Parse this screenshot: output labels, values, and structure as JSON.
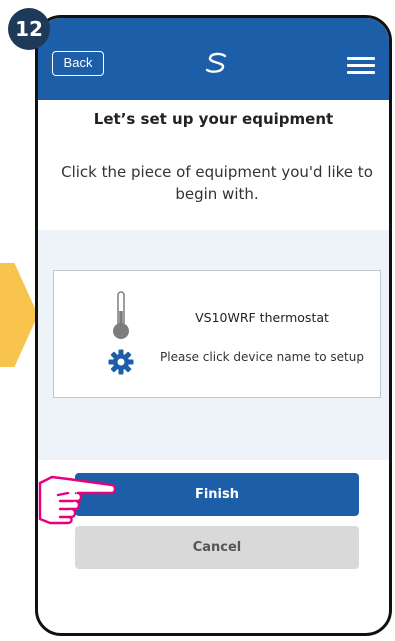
{
  "step_badge": "12",
  "header": {
    "back_label": "Back",
    "logo_icon": "brand-s-logo-icon",
    "menu_icon": "hamburger-menu-icon"
  },
  "main": {
    "title": "Let’s set up your equipment",
    "subtitle": "Click the piece of equipment you'd like to begin with."
  },
  "device": {
    "name": "VS10WRF thermostat",
    "hint": "Please click device name to setup",
    "icons": [
      "thermometer-icon",
      "gear-icon"
    ]
  },
  "actions": {
    "finish_label": "Finish",
    "cancel_label": "Cancel"
  },
  "colors": {
    "header_bg": "#1c5ea8",
    "primary_button": "#1c5ea8",
    "secondary_button": "#d9d9d9",
    "panel_bg": "#eef3f9",
    "accent_pink": "#e6007e",
    "arrow_yellow": "#f8c44e",
    "badge_bg": "#1f3a59"
  }
}
